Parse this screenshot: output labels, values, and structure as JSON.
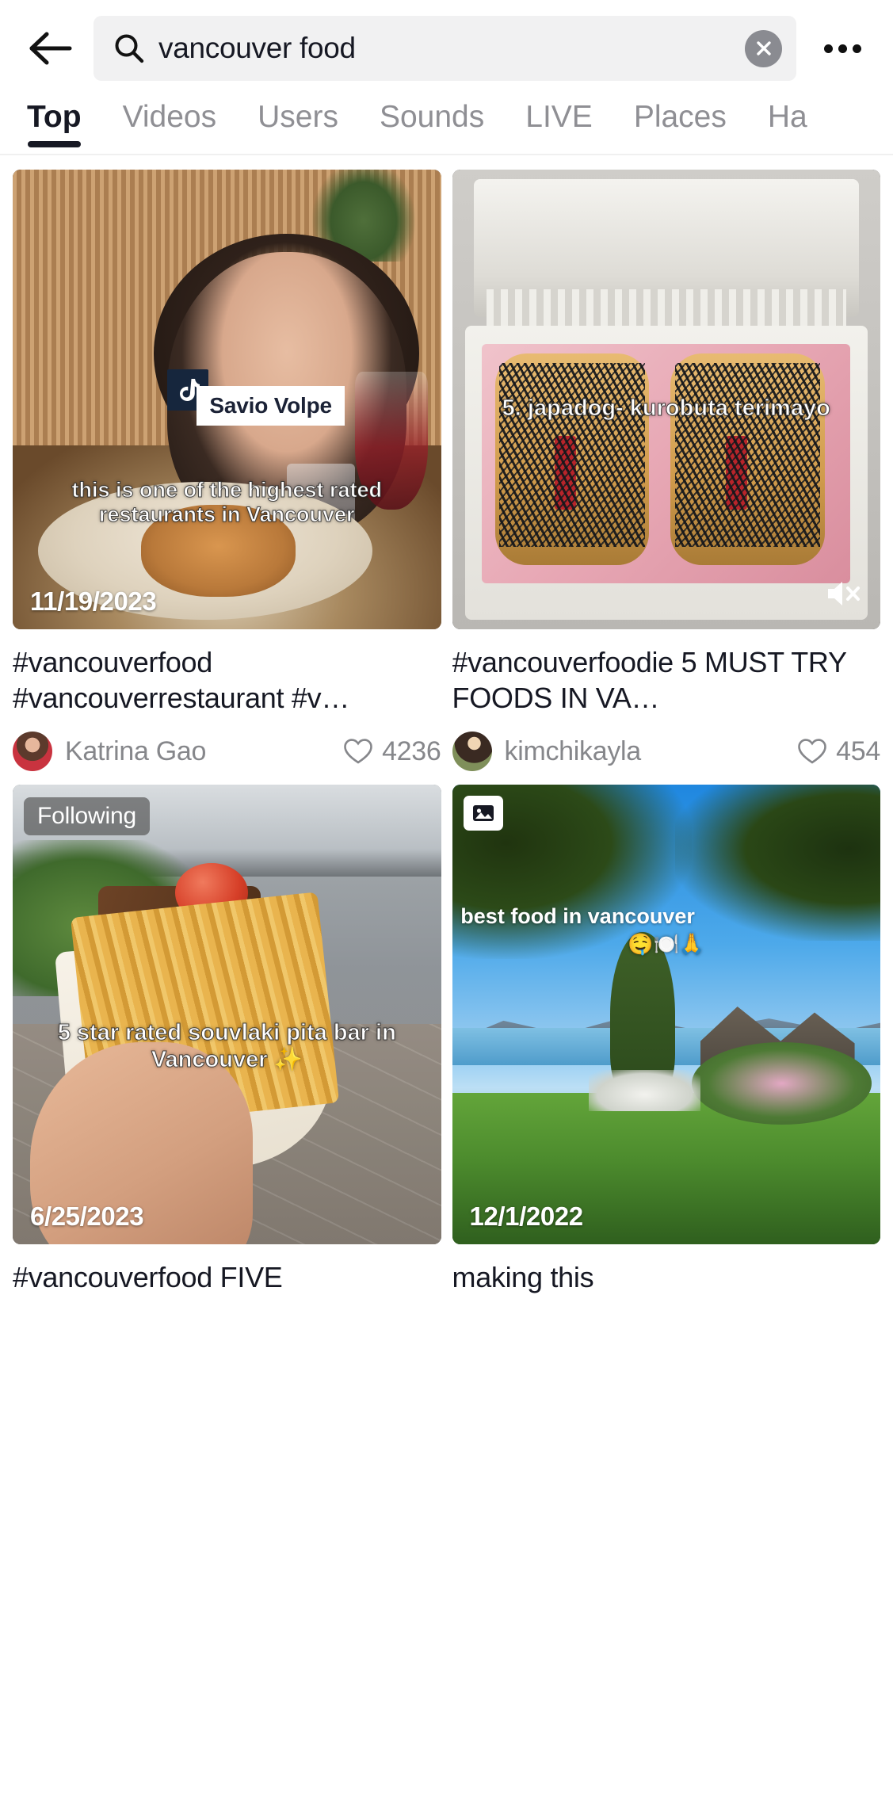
{
  "header": {
    "back_icon": "arrow-left-icon",
    "more_icon": "more-options-icon"
  },
  "search": {
    "icon": "search-icon",
    "value": "vancouver food",
    "placeholder": "Search",
    "clear_icon": "clear-icon"
  },
  "tabs": [
    {
      "label": "Top",
      "active": true
    },
    {
      "label": "Videos",
      "active": false
    },
    {
      "label": "Users",
      "active": false
    },
    {
      "label": "Sounds",
      "active": false
    },
    {
      "label": "LIVE",
      "active": false
    },
    {
      "label": "Places",
      "active": false
    },
    {
      "label": "Ha",
      "active": false
    }
  ],
  "results": [
    {
      "title": "#vancouverfood #vancouverrestaurant #v…",
      "author": "Katrina Gao",
      "likes": "4236",
      "like_icon": "heart-icon",
      "date": "11/19/2023",
      "video_caption": "this is one of the highest rated restaurants in Vancouver",
      "place_label": "Savio Volpe",
      "place_logo": "tiktok-logo-icon"
    },
    {
      "title": "#vancouverfoodie 5 MUST TRY FOODS IN VA…",
      "author": "kimchikayla",
      "likes": "454",
      "like_icon": "heart-icon",
      "date": "",
      "video_caption": "5. japadog- kurobuta terimayo",
      "mute_icon": "muted-speaker-icon"
    },
    {
      "title": "#vancouverfood FIVE",
      "author": "",
      "likes": "",
      "like_icon": "heart-icon",
      "date": "6/25/2023",
      "video_caption": "5 star rated souvlaki pita bar in Vancouver ✨",
      "following_badge": "Following"
    },
    {
      "title": "making this",
      "author": "",
      "likes": "",
      "like_icon": "heart-icon",
      "date": "12/1/2022",
      "video_caption": "best food in vancouver",
      "video_caption_emoji": "🤤🍽️🙏",
      "photos_badge": "photo-collection-icon"
    }
  ],
  "colors": {
    "text_primary": "#161823",
    "text_secondary": "#86878b",
    "tab_inactive": "#8f8f94",
    "search_bg": "#f1f1f2",
    "clear_bg": "#8a8b91"
  }
}
